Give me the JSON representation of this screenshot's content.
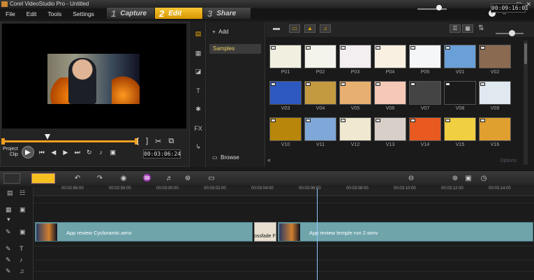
{
  "window": {
    "title": "Corel VideoStudio Pro - Untitled",
    "controls": [
      "–",
      "▢",
      "✕"
    ]
  },
  "menu": [
    "File",
    "Edit",
    "Tools",
    "Settings"
  ],
  "steps": [
    {
      "num": "1",
      "label": "Capture",
      "active": false
    },
    {
      "num": "2",
      "label": "Edit",
      "active": true
    },
    {
      "num": "3",
      "label": "Share",
      "active": false
    }
  ],
  "preview": {
    "mode_project": "Project",
    "mode_clip": "Clip",
    "timecode": "00:03:06:24",
    "scrub_position": 0.33
  },
  "library": {
    "add_label": "Add",
    "folder": "Samples",
    "browse_label": "Browse",
    "options_label": "Options",
    "thumbnails": [
      {
        "label": "P01",
        "color": "#f1f0e0"
      },
      {
        "label": "P02",
        "color": "#f5f4ec"
      },
      {
        "label": "P03",
        "color": "#f3eeef"
      },
      {
        "label": "P04",
        "color": "#faf0e2"
      },
      {
        "label": "P05",
        "color": "#f4f6f8"
      },
      {
        "label": "V01",
        "color": "#6aa0d8"
      },
      {
        "label": "V02",
        "color": "#8a6a50"
      },
      {
        "label": "V03",
        "color": "#2d58c0"
      },
      {
        "label": "V04",
        "color": "#c49a40"
      },
      {
        "label": "V05",
        "color": "#e8b070"
      },
      {
        "label": "V06",
        "color": "#f5c8b8"
      },
      {
        "label": "V07",
        "color": "#444444"
      },
      {
        "label": "V08",
        "color": "#1a1a1a"
      },
      {
        "label": "V09",
        "color": "#e0e8f0"
      },
      {
        "label": "V10",
        "color": "#b8860b"
      },
      {
        "label": "V11",
        "color": "#7fa8d8"
      },
      {
        "label": "V12",
        "color": "#f0e8d0"
      },
      {
        "label": "V13",
        "color": "#d8d0c8"
      },
      {
        "label": "V14",
        "color": "#e85a20"
      },
      {
        "label": "V15",
        "color": "#f0d040"
      },
      {
        "label": "V16",
        "color": "#e0a030"
      }
    ]
  },
  "timeline": {
    "timecode": "00:09:16:01",
    "ruler": [
      "00:02:56:00",
      "00:02:58:00",
      "00:03:00:00",
      "00:03:02:00",
      "00:03:04:00",
      "00:03:06:00",
      "00:03:08:00",
      "00:03:10:00",
      "00:03:12:00",
      "00:03:14:00"
    ],
    "clips": [
      {
        "label": "App review Cycloramic.wmv"
      },
      {
        "label": "App review temple run 2.wmv"
      }
    ],
    "transition_label": "ossfade F"
  }
}
